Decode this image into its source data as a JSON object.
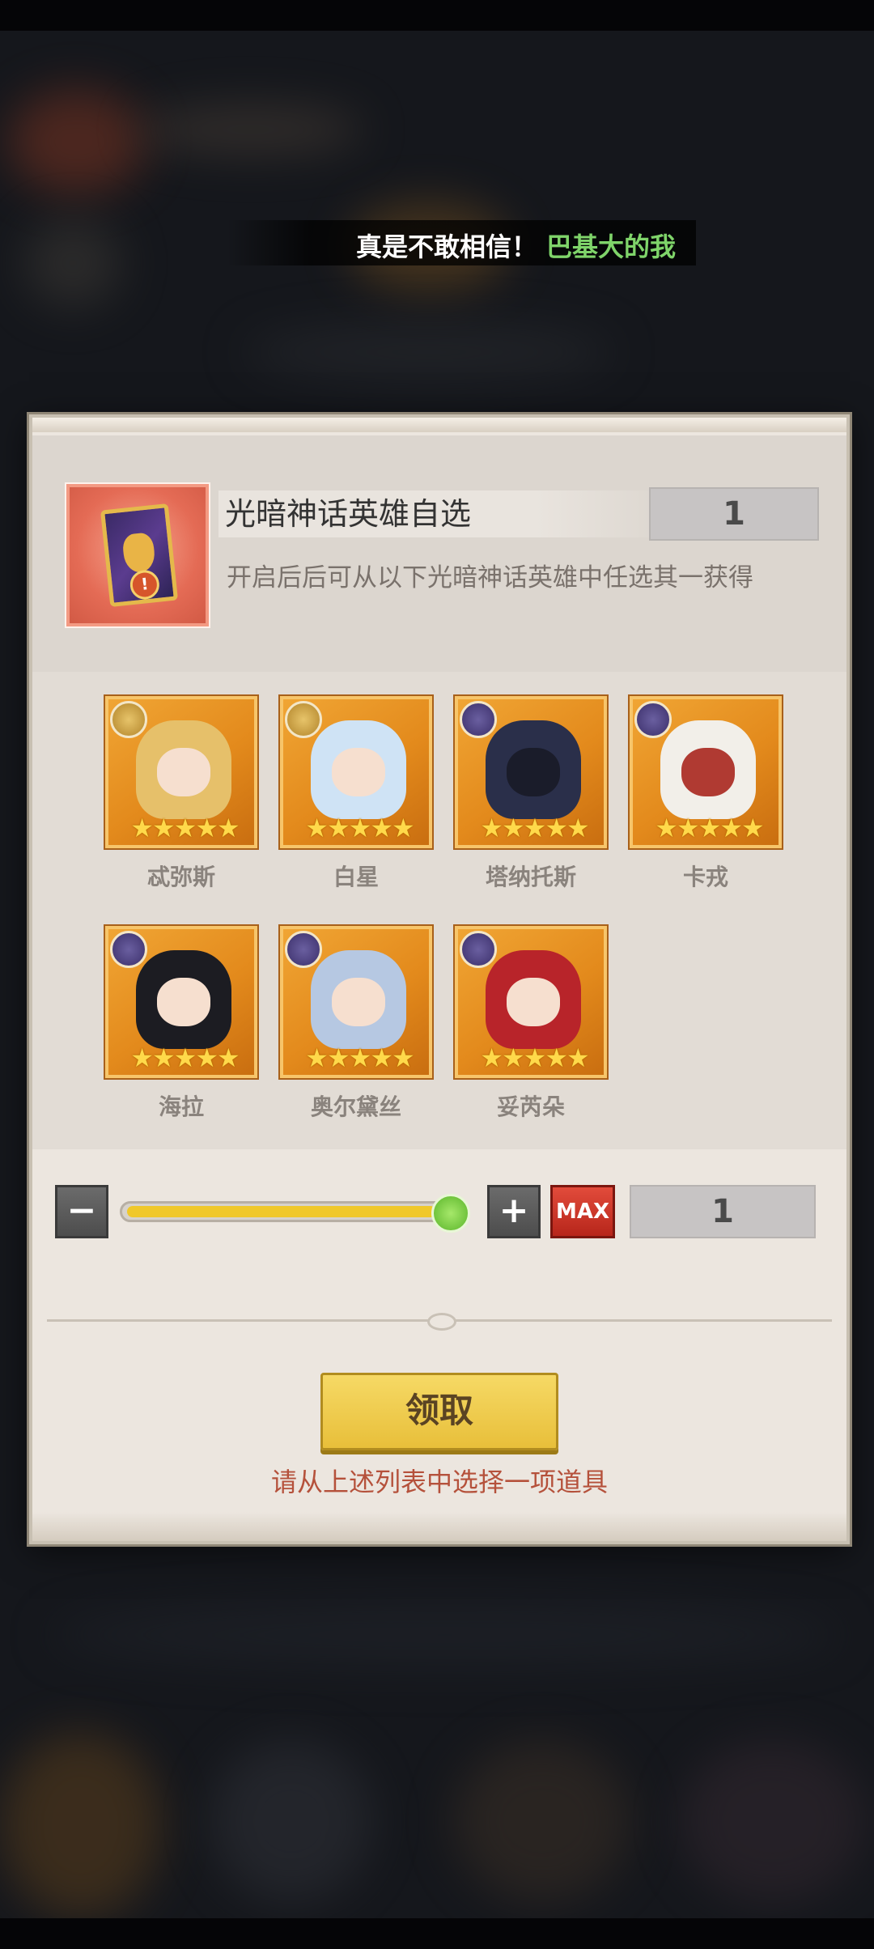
{
  "ticker": {
    "part1": "真是不敢相信！",
    "part2": "巴基大的我"
  },
  "item": {
    "title": "光暗神话英雄自选",
    "quantity": "1",
    "description": "开启后后可从以下光暗神话英雄中任选其一获得"
  },
  "heroes": [
    {
      "name": "忒弥斯",
      "element": "light",
      "stars": "★★★★★"
    },
    {
      "name": "白星",
      "element": "light",
      "stars": "★★★★★"
    },
    {
      "name": "塔纳托斯",
      "element": "dark",
      "stars": "★★★★★"
    },
    {
      "name": "卡戎",
      "element": "dark",
      "stars": "★★★★★"
    },
    {
      "name": "海拉",
      "element": "dark",
      "stars": "★★★★★"
    },
    {
      "name": "奥尔黛丝",
      "element": "dark",
      "stars": "★★★★★"
    },
    {
      "name": "妥芮朵",
      "element": "dark",
      "stars": "★★★★★"
    }
  ],
  "selector": {
    "minus_label": "−",
    "plus_label": "+",
    "max_label": "MAX",
    "count": "1",
    "slider_fraction": 1.0
  },
  "actions": {
    "claim_label": "领取",
    "hint": "请从上述列表中选择一项道具"
  },
  "colors": {
    "accent_gold": "#e8bf3a",
    "hint_red": "#b5513b",
    "ticker_green": "#7fd46a"
  }
}
